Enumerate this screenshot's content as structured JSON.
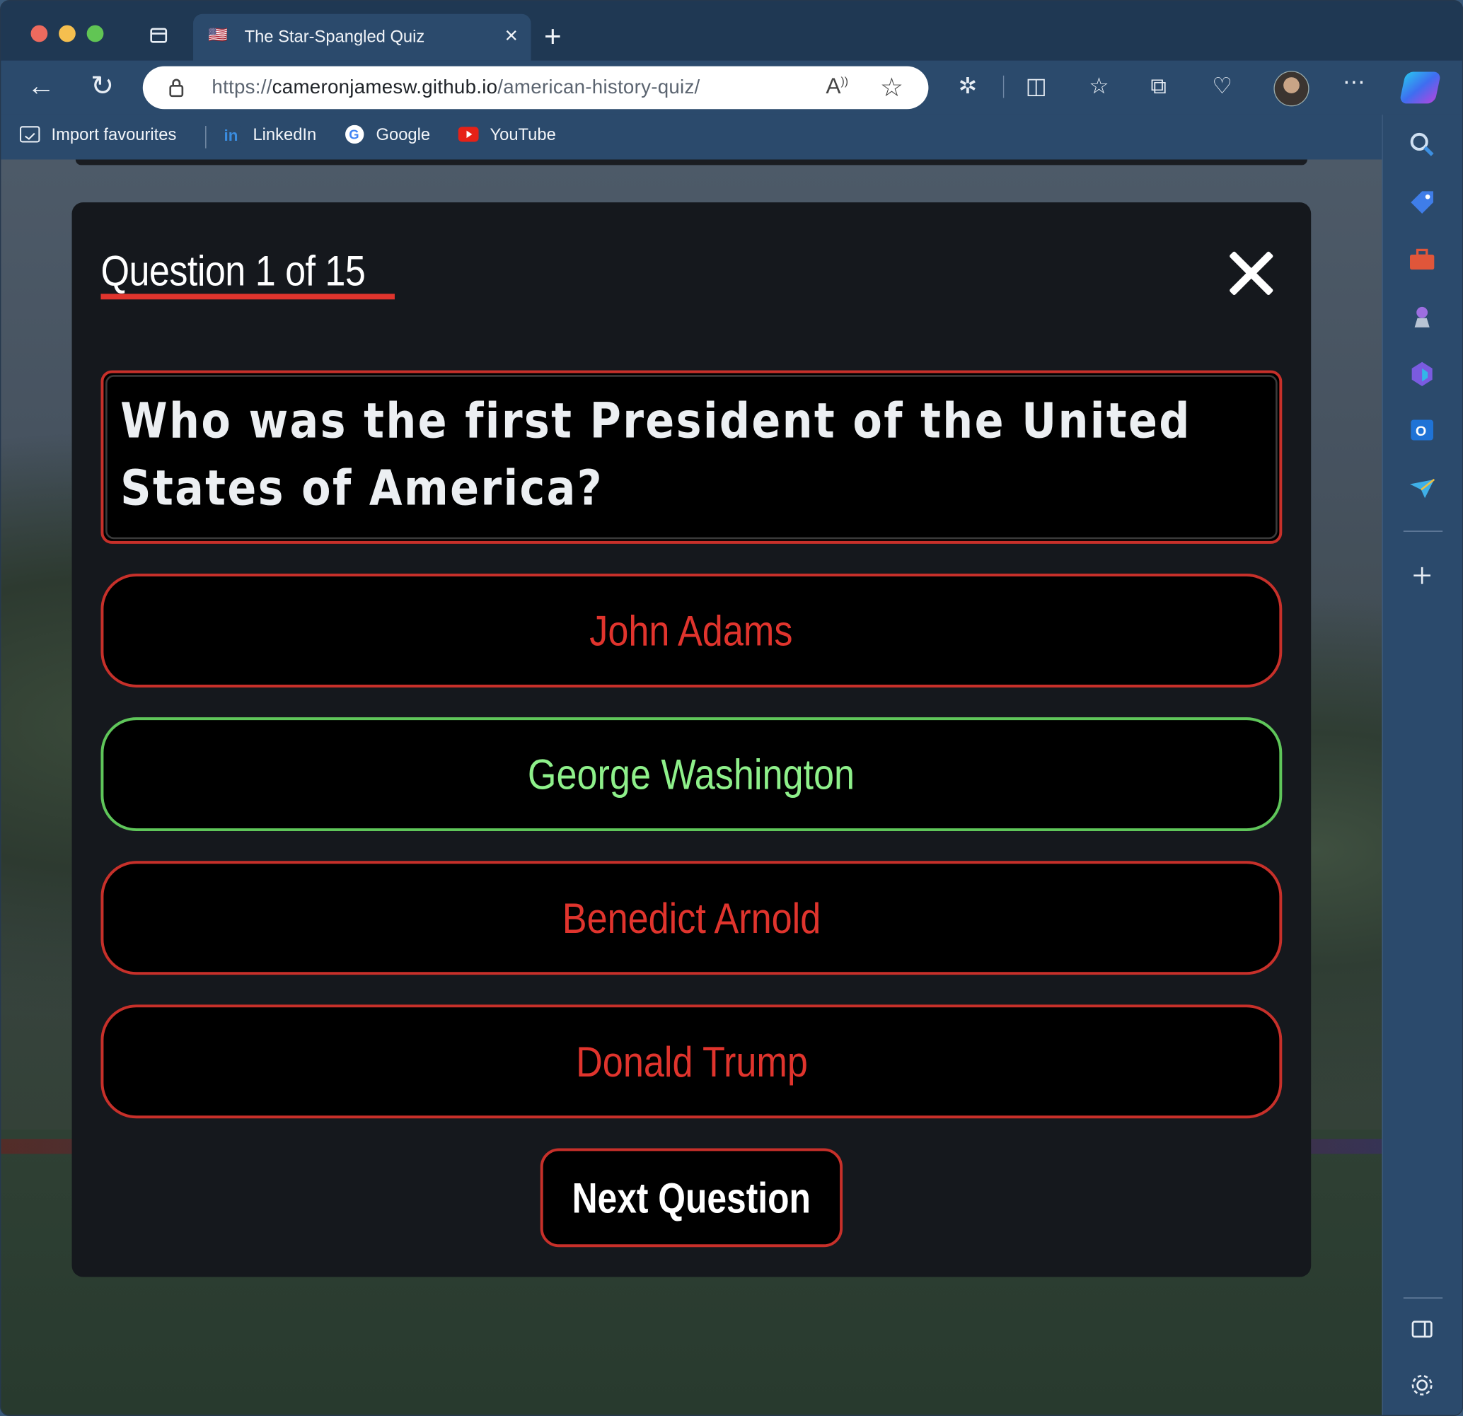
{
  "browser": {
    "tab": {
      "title": "The Star-Spangled Quiz",
      "favicon": "us-flag-icon",
      "close": "×"
    },
    "new_tab": "+",
    "address": {
      "scheme": "https://",
      "host": "cameronjamesw.github.io",
      "path": "/american-history-quiz/"
    },
    "favourites": [
      {
        "label": "Import favourites",
        "icon": "import-icon"
      },
      {
        "label": "LinkedIn",
        "icon": "linkedin-icon"
      },
      {
        "label": "Google",
        "icon": "google-icon"
      },
      {
        "label": "YouTube",
        "icon": "youtube-icon"
      }
    ]
  },
  "quiz": {
    "heading": "Question 1 of 15",
    "question": "Who was the first President of the United States of America?",
    "answers": [
      {
        "label": "John Adams",
        "state": "incorrect"
      },
      {
        "label": "George Washington",
        "state": "correct"
      },
      {
        "label": "Benedict Arnold",
        "state": "incorrect"
      },
      {
        "label": "Donald Trump",
        "state": "incorrect"
      }
    ],
    "next_label": "Next Question"
  },
  "colors": {
    "accent_red": "#e0342d",
    "correct_green": "#8ef08a",
    "modal_bg": "#15181d"
  }
}
